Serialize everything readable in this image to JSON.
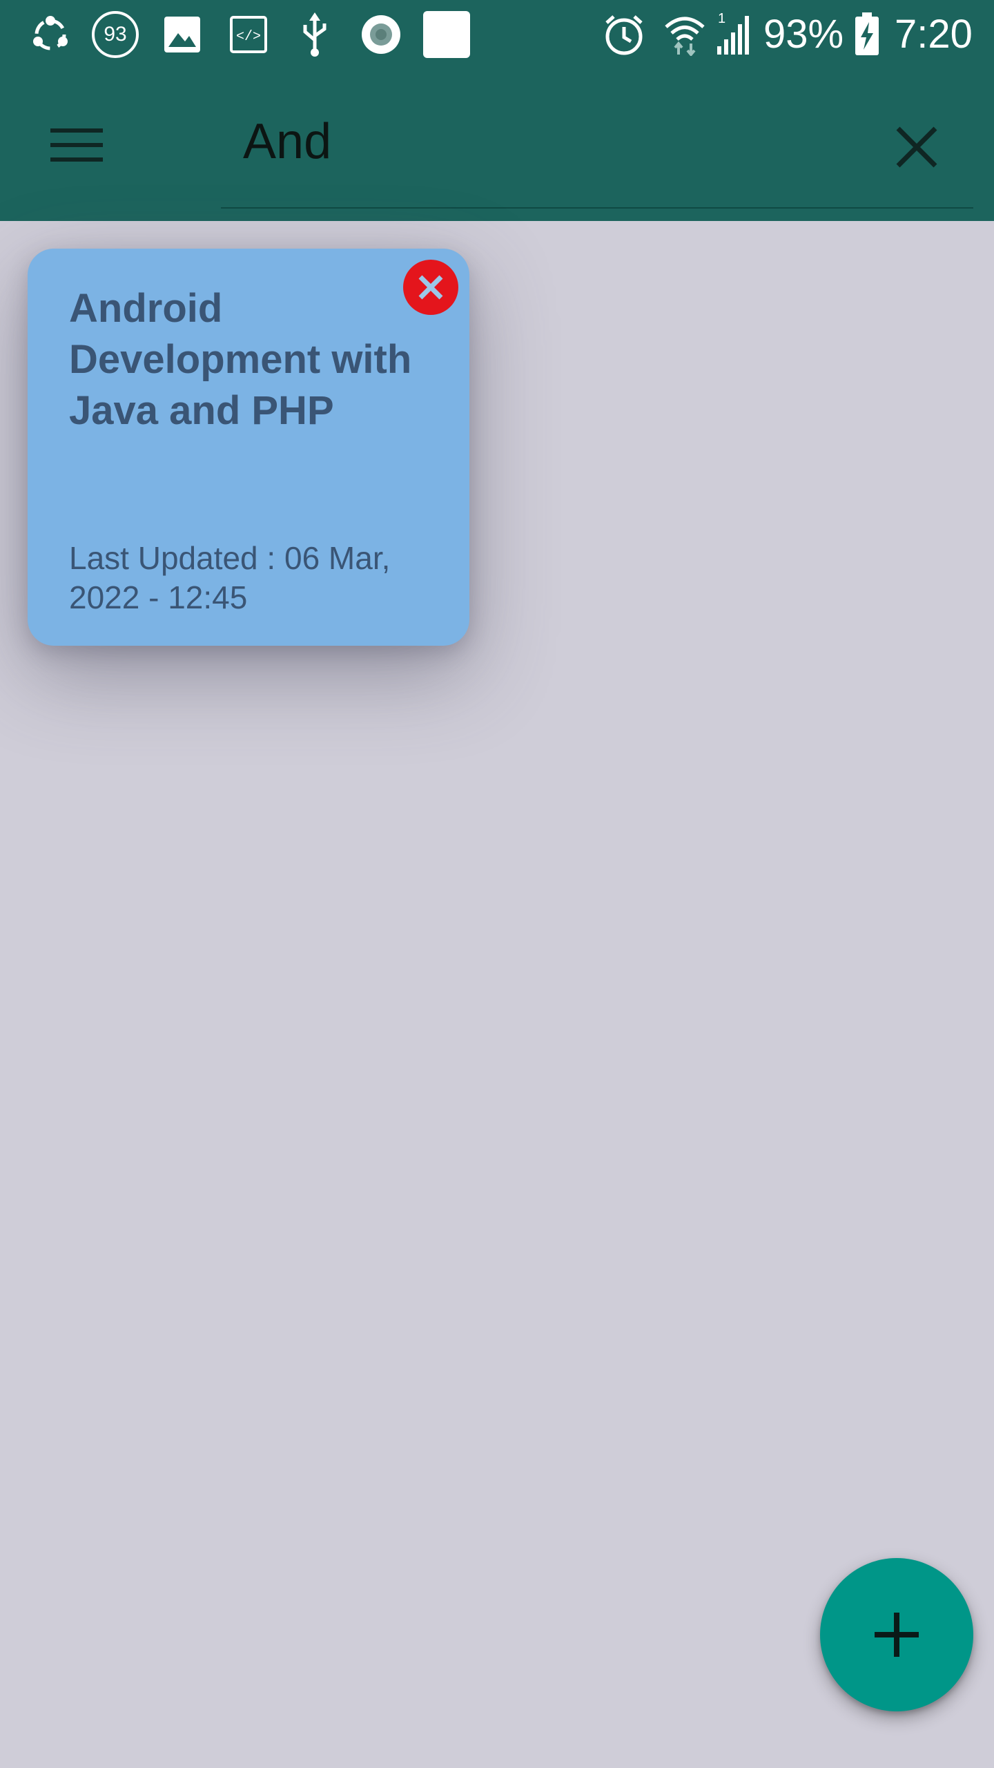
{
  "status_bar": {
    "notification_badge": "93",
    "battery_percent": "93%",
    "time": "7:20",
    "signal_sim_label": "1",
    "icons": [
      "share-icon",
      "circle-count-icon",
      "image-icon",
      "code-icon",
      "usb-icon",
      "record-icon",
      "blank-square-icon",
      "alarm-icon",
      "wifi-icon",
      "signal-icon",
      "battery-charging-icon"
    ]
  },
  "app_bar": {
    "search_value": "And",
    "menu_icon": "hamburger-menu-icon",
    "clear_icon": "close-icon"
  },
  "notes": [
    {
      "title": "Android Development with Java and PHP",
      "last_updated": "Last Updated : 06 Mar, 2022 - 12:45",
      "color": "#7cb3e4",
      "delete_icon": "close-circle-icon"
    }
  ],
  "fab": {
    "icon": "plus-icon"
  },
  "colors": {
    "primary": "#1c645d",
    "accent": "#009688",
    "background": "#cfcdd8",
    "note_text": "#3a5575",
    "delete": "#e4151c"
  }
}
